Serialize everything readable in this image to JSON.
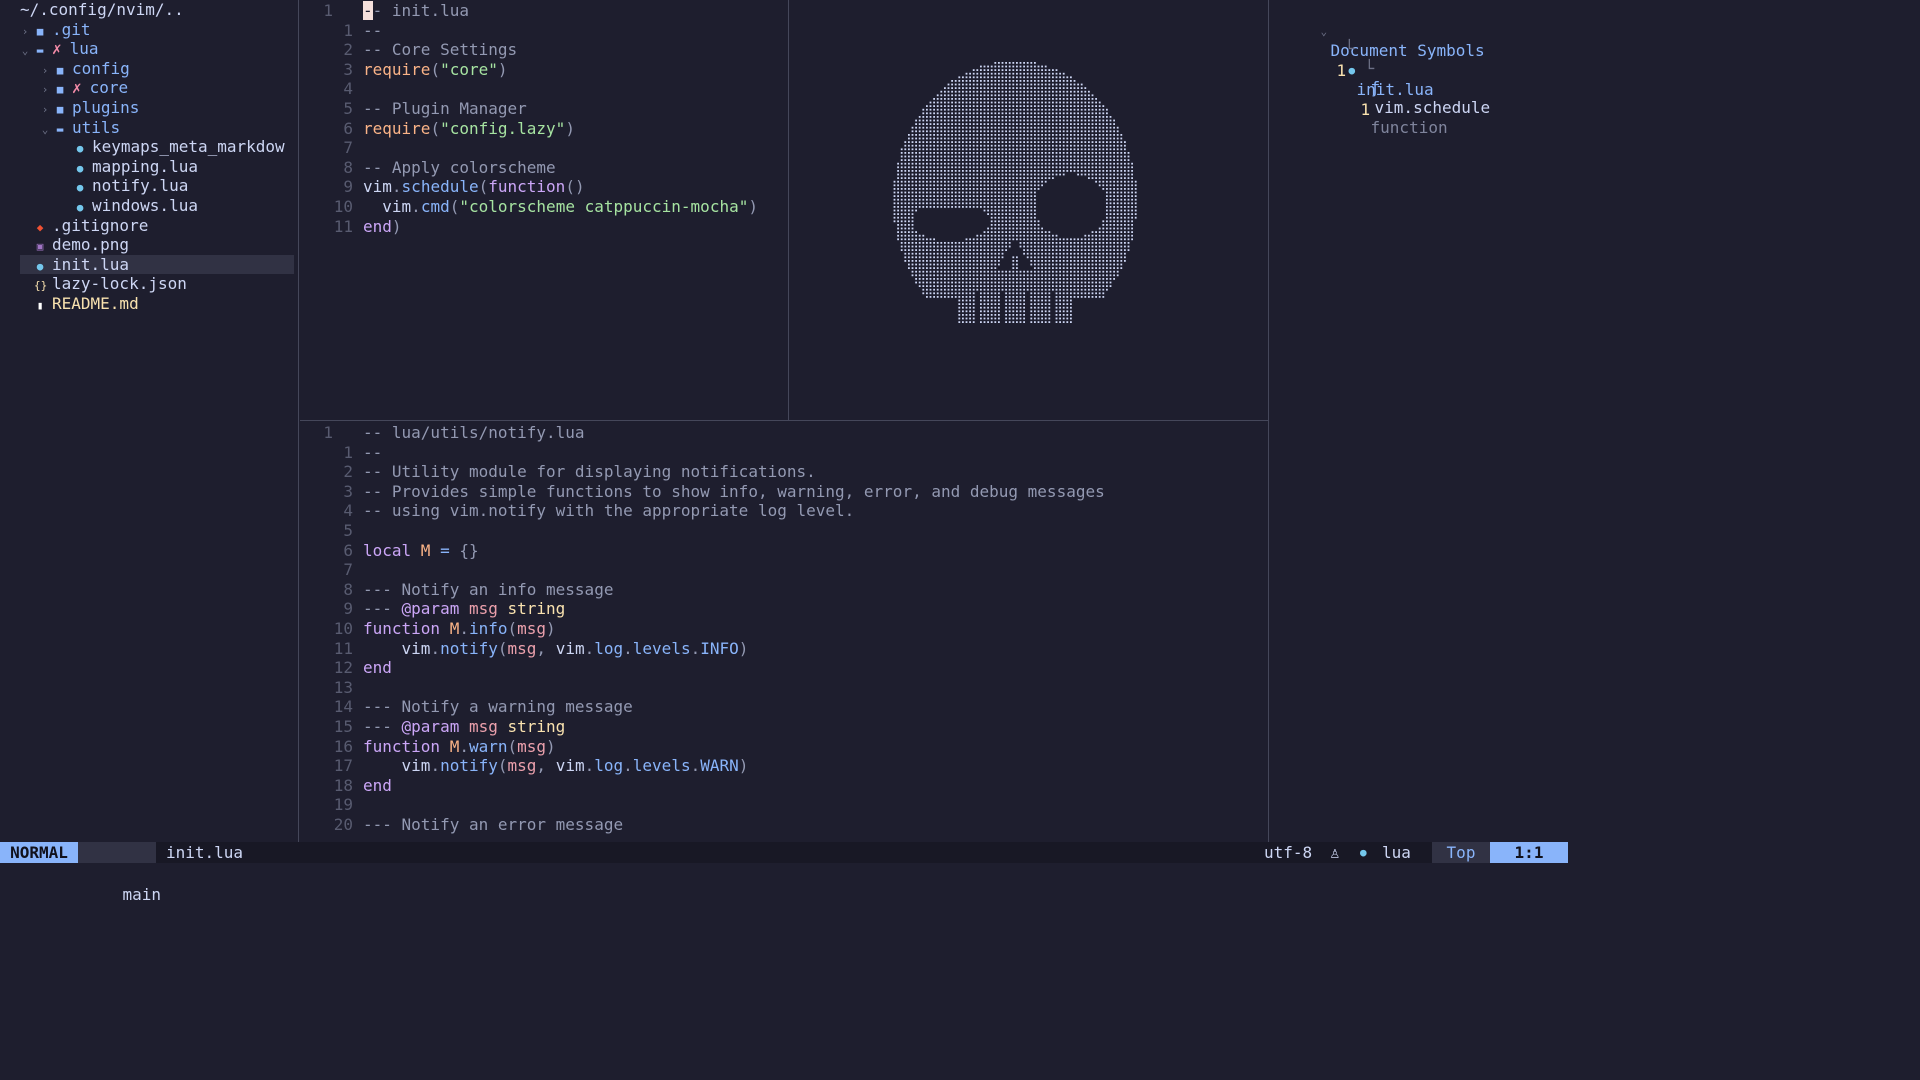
{
  "tree": {
    "root": "~/.config/nvim/..",
    "items": [
      {
        "label": ".git",
        "depth": 0,
        "chevron": "›",
        "icon": "■",
        "icon_color": "#89b4fa",
        "text_color": "#89b4fa",
        "mark": ""
      },
      {
        "label": "lua",
        "depth": 0,
        "chevron": "⌄",
        "icon": "▬",
        "icon_color": "#89b4fa",
        "text_color": "#89b4fa",
        "mark": "✗"
      },
      {
        "label": "config",
        "depth": 1,
        "chevron": "›",
        "icon": "■",
        "icon_color": "#89b4fa",
        "text_color": "#89b4fa",
        "mark": ""
      },
      {
        "label": "core",
        "depth": 1,
        "chevron": "›",
        "icon": "■",
        "icon_color": "#89b4fa",
        "text_color": "#89b4fa",
        "mark": "✗"
      },
      {
        "label": "plugins",
        "depth": 1,
        "chevron": "›",
        "icon": "■",
        "icon_color": "#89b4fa",
        "text_color": "#89b4fa",
        "mark": ""
      },
      {
        "label": "utils",
        "depth": 1,
        "chevron": "⌄",
        "icon": "▬",
        "icon_color": "#89b4fa",
        "text_color": "#89b4fa",
        "mark": ""
      },
      {
        "label": "keymaps_meta_markdow",
        "depth": 2,
        "chevron": "",
        "icon": "●",
        "icon_color": "#74c7ec",
        "text_color": "#cdd6f4",
        "mark": ""
      },
      {
        "label": "mapping.lua",
        "depth": 2,
        "chevron": "",
        "icon": "●",
        "icon_color": "#74c7ec",
        "text_color": "#cdd6f4",
        "mark": ""
      },
      {
        "label": "notify.lua",
        "depth": 2,
        "chevron": "",
        "icon": "●",
        "icon_color": "#74c7ec",
        "text_color": "#cdd6f4",
        "mark": ""
      },
      {
        "label": "windows.lua",
        "depth": 2,
        "chevron": "",
        "icon": "●",
        "icon_color": "#74c7ec",
        "text_color": "#cdd6f4",
        "mark": ""
      },
      {
        "label": ".gitignore",
        "depth": 0,
        "chevron": "",
        "icon": "◆",
        "icon_color": "#f05133",
        "text_color": "#cdd6f4",
        "mark": ""
      },
      {
        "label": "demo.png",
        "depth": 0,
        "chevron": "",
        "icon": "▣",
        "icon_color": "#a074c4",
        "text_color": "#cdd6f4",
        "mark": ""
      },
      {
        "label": "init.lua",
        "depth": 0,
        "chevron": "",
        "icon": "●",
        "icon_color": "#74c7ec",
        "text_color": "#cdd6f4",
        "mark": "",
        "selected": true
      },
      {
        "label": "lazy-lock.json",
        "depth": 0,
        "chevron": "",
        "icon": "{}",
        "icon_color": "#f9e2af",
        "text_color": "#cdd6f4",
        "mark": ""
      },
      {
        "label": "README.md",
        "depth": 0,
        "chevron": "",
        "icon": "▮",
        "icon_color": "#ffffff",
        "text_color": "#f9e2af",
        "mark": ""
      }
    ]
  },
  "top_editor": {
    "lines": [
      {
        "num": "1",
        "cur": true,
        "tokens": [
          {
            "t": "-",
            "c": "cursor"
          },
          {
            "t": "- init.lua",
            "c": "c-com"
          }
        ]
      },
      {
        "num": "1",
        "tokens": [
          {
            "t": "--",
            "c": "c-com"
          }
        ]
      },
      {
        "num": "2",
        "tokens": [
          {
            "t": "-- Core Settings",
            "c": "c-com"
          }
        ]
      },
      {
        "num": "3",
        "tokens": [
          {
            "t": "require",
            "c": "c-const"
          },
          {
            "t": "(",
            "c": "c-punc"
          },
          {
            "t": "\"core\"",
            "c": "c-str"
          },
          {
            "t": ")",
            "c": "c-punc"
          }
        ]
      },
      {
        "num": "4",
        "tokens": []
      },
      {
        "num": "5",
        "tokens": [
          {
            "t": "-- Plugin Manager",
            "c": "c-com"
          }
        ]
      },
      {
        "num": "6",
        "tokens": [
          {
            "t": "require",
            "c": "c-const"
          },
          {
            "t": "(",
            "c": "c-punc"
          },
          {
            "t": "\"config.lazy\"",
            "c": "c-str"
          },
          {
            "t": ")",
            "c": "c-punc"
          }
        ]
      },
      {
        "num": "7",
        "tokens": []
      },
      {
        "num": "8",
        "tokens": [
          {
            "t": "-- Apply colorscheme",
            "c": "c-com"
          }
        ]
      },
      {
        "num": "9",
        "tokens": [
          {
            "t": "vim",
            "c": "c-var"
          },
          {
            "t": ".",
            "c": "c-punc"
          },
          {
            "t": "schedule",
            "c": "c-fn"
          },
          {
            "t": "(",
            "c": "c-punc"
          },
          {
            "t": "function",
            "c": "c-kw"
          },
          {
            "t": "()",
            "c": "c-punc"
          }
        ]
      },
      {
        "num": "10",
        "tokens": [
          {
            "t": "  vim",
            "c": "c-var"
          },
          {
            "t": ".",
            "c": "c-punc"
          },
          {
            "t": "cmd",
            "c": "c-fn"
          },
          {
            "t": "(",
            "c": "c-punc"
          },
          {
            "t": "\"colorscheme catppuccin-mocha\"",
            "c": "c-str"
          },
          {
            "t": ")",
            "c": "c-punc"
          }
        ]
      },
      {
        "num": "11",
        "tokens": [
          {
            "t": "end",
            "c": "c-kw"
          },
          {
            "t": ")",
            "c": "c-punc"
          }
        ]
      }
    ]
  },
  "bottom_editor": {
    "lines": [
      {
        "num": "1",
        "cur": true,
        "tokens": [
          {
            "t": "-- lua/utils/notify.lua",
            "c": "c-com"
          }
        ]
      },
      {
        "num": "1",
        "tokens": [
          {
            "t": "--",
            "c": "c-com"
          }
        ]
      },
      {
        "num": "2",
        "tokens": [
          {
            "t": "-- Utility module for displaying notifications.",
            "c": "c-com"
          }
        ]
      },
      {
        "num": "3",
        "tokens": [
          {
            "t": "-- Provides simple functions to show info, warning, error, and debug messages",
            "c": "c-com"
          }
        ]
      },
      {
        "num": "4",
        "tokens": [
          {
            "t": "-- using vim.notify with the appropriate log level.",
            "c": "c-com"
          }
        ]
      },
      {
        "num": "5",
        "tokens": []
      },
      {
        "num": "6",
        "tokens": [
          {
            "t": "local",
            "c": "c-kw"
          },
          {
            "t": " M ",
            "c": "c-const"
          },
          {
            "t": "=",
            "c": "c-fn"
          },
          {
            "t": " {}",
            "c": "c-punc"
          }
        ]
      },
      {
        "num": "7",
        "tokens": []
      },
      {
        "num": "8",
        "tokens": [
          {
            "t": "--- Notify an info message",
            "c": "c-com"
          }
        ]
      },
      {
        "num": "9",
        "tokens": [
          {
            "t": "--- ",
            "c": "c-com"
          },
          {
            "t": "@param",
            "c": "c-tag"
          },
          {
            "t": " msg ",
            "c": "c-param"
          },
          {
            "t": "string",
            "c": "c-type"
          }
        ]
      },
      {
        "num": "10",
        "tokens": [
          {
            "t": "function",
            "c": "c-kw"
          },
          {
            "t": " M",
            "c": "c-const"
          },
          {
            "t": ".",
            "c": "c-punc"
          },
          {
            "t": "info",
            "c": "c-fn"
          },
          {
            "t": "(",
            "c": "c-punc"
          },
          {
            "t": "msg",
            "c": "c-param"
          },
          {
            "t": ")",
            "c": "c-punc"
          }
        ]
      },
      {
        "num": "11",
        "tokens": [
          {
            "t": "    vim",
            "c": "c-var"
          },
          {
            "t": ".",
            "c": "c-punc"
          },
          {
            "t": "notify",
            "c": "c-fn"
          },
          {
            "t": "(",
            "c": "c-punc"
          },
          {
            "t": "msg",
            "c": "c-param"
          },
          {
            "t": ", ",
            "c": "c-punc"
          },
          {
            "t": "vim",
            "c": "c-var"
          },
          {
            "t": ".",
            "c": "c-punc"
          },
          {
            "t": "log",
            "c": "c-fn"
          },
          {
            "t": ".",
            "c": "c-punc"
          },
          {
            "t": "levels",
            "c": "c-fn"
          },
          {
            "t": ".",
            "c": "c-punc"
          },
          {
            "t": "INFO",
            "c": "c-fn"
          },
          {
            "t": ")",
            "c": "c-punc"
          }
        ]
      },
      {
        "num": "12",
        "tokens": [
          {
            "t": "end",
            "c": "c-kw"
          }
        ]
      },
      {
        "num": "13",
        "tokens": []
      },
      {
        "num": "14",
        "tokens": [
          {
            "t": "--- Notify a warning message",
            "c": "c-com"
          }
        ]
      },
      {
        "num": "15",
        "tokens": [
          {
            "t": "--- ",
            "c": "c-com"
          },
          {
            "t": "@param",
            "c": "c-tag"
          },
          {
            "t": " msg ",
            "c": "c-param"
          },
          {
            "t": "string",
            "c": "c-type"
          }
        ]
      },
      {
        "num": "16",
        "tokens": [
          {
            "t": "function",
            "c": "c-kw"
          },
          {
            "t": " M",
            "c": "c-const"
          },
          {
            "t": ".",
            "c": "c-punc"
          },
          {
            "t": "warn",
            "c": "c-fn"
          },
          {
            "t": "(",
            "c": "c-punc"
          },
          {
            "t": "msg",
            "c": "c-param"
          },
          {
            "t": ")",
            "c": "c-punc"
          }
        ]
      },
      {
        "num": "17",
        "tokens": [
          {
            "t": "    vim",
            "c": "c-var"
          },
          {
            "t": ".",
            "c": "c-punc"
          },
          {
            "t": "notify",
            "c": "c-fn"
          },
          {
            "t": "(",
            "c": "c-punc"
          },
          {
            "t": "msg",
            "c": "c-param"
          },
          {
            "t": ", ",
            "c": "c-punc"
          },
          {
            "t": "vim",
            "c": "c-var"
          },
          {
            "t": ".",
            "c": "c-punc"
          },
          {
            "t": "log",
            "c": "c-fn"
          },
          {
            "t": ".",
            "c": "c-punc"
          },
          {
            "t": "levels",
            "c": "c-fn"
          },
          {
            "t": ".",
            "c": "c-punc"
          },
          {
            "t": "WARN",
            "c": "c-fn"
          },
          {
            "t": ")",
            "c": "c-punc"
          }
        ]
      },
      {
        "num": "18",
        "tokens": [
          {
            "t": "end",
            "c": "c-kw"
          }
        ]
      },
      {
        "num": "19",
        "tokens": []
      },
      {
        "num": "20",
        "tokens": [
          {
            "t": "--- Notify an error message",
            "c": "c-com"
          }
        ]
      }
    ]
  },
  "outline": {
    "header_chevron": "⌄",
    "title": "Document Symbols",
    "title_count": "1",
    "file": "init.lua",
    "file_count": "1",
    "symbol_icon": "ƒ",
    "symbol": "vim.schedule",
    "symbol_kind": "function"
  },
  "ascii_art": {
    "name": "skull"
  },
  "statusline": {
    "mode": "NORMAL",
    "branch_icon": "ᚠ",
    "branch": "main",
    "filename": "init.lua",
    "encoding": "utf-8",
    "os_icon": "♙",
    "ft_icon": "●",
    "filetype": "lua",
    "position": "Top",
    "cursor": "1:1"
  },
  "colors": {
    "bg": "#1e1e2e",
    "mantle": "#181825",
    "blue": "#89b4fa",
    "surface": "#45475a"
  }
}
